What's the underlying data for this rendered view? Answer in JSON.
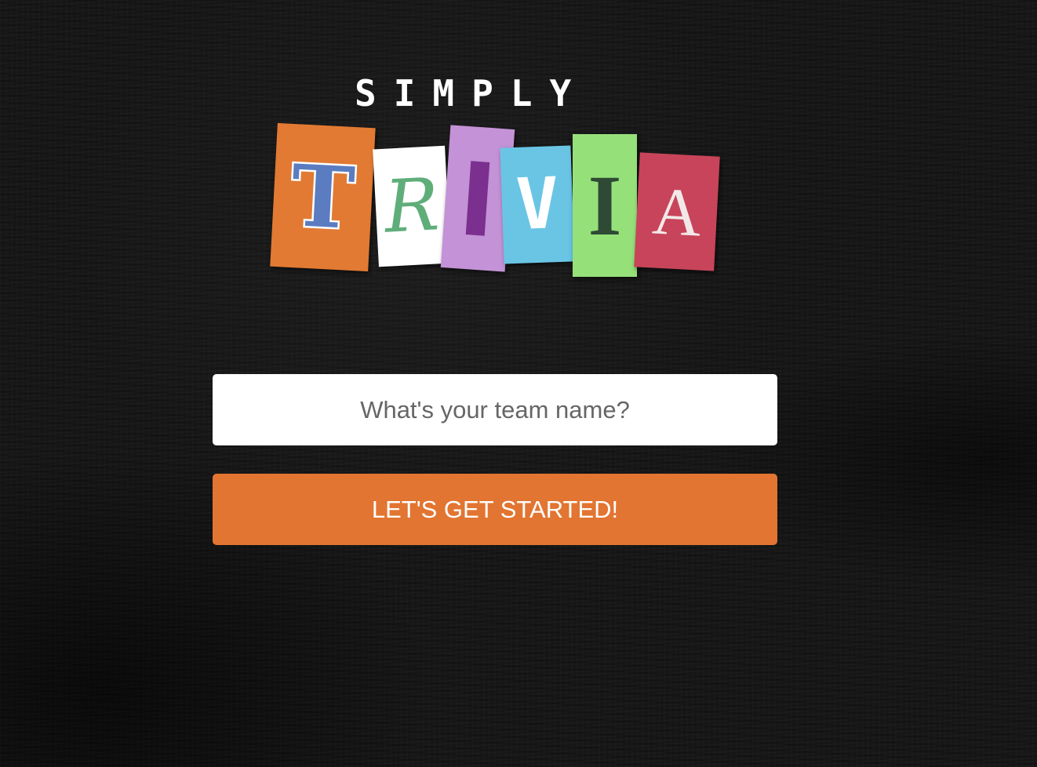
{
  "logo": {
    "top_word": "SIMPLY",
    "letters": [
      "T",
      "R",
      "I",
      "V",
      "I",
      "A"
    ]
  },
  "colors": {
    "background": "#161616",
    "tile_t": "#e27a33",
    "tile_r": "#ffffff",
    "tile_i1": "#c492d6",
    "tile_v": "#6ac5e5",
    "tile_i2": "#96e07a",
    "tile_a": "#c8445a",
    "button": "#e27531"
  },
  "form": {
    "team_name_value": "",
    "team_name_placeholder": "What's your team name?",
    "start_label": "LET'S GET STARTED!"
  }
}
